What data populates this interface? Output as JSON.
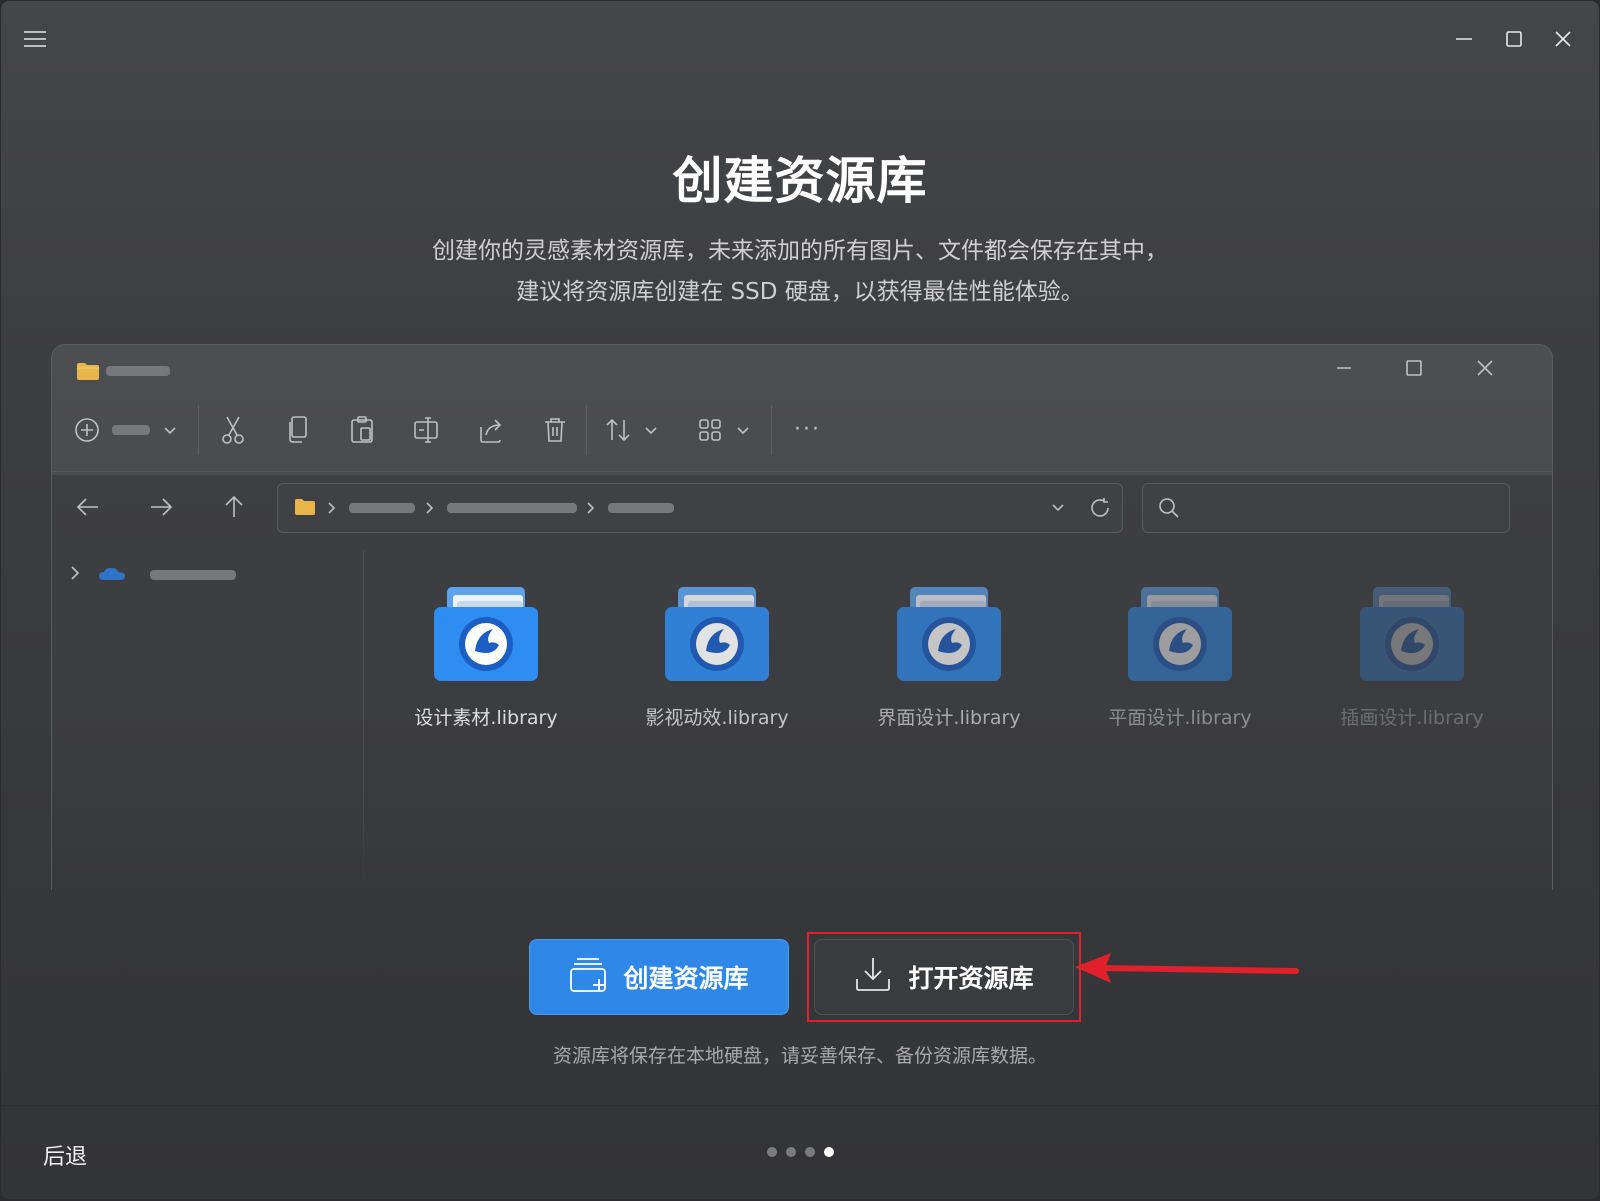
{
  "titlebar": {
    "menu_icon": "hamburger-menu-icon",
    "controls": [
      "minimize-icon",
      "maximize-icon",
      "close-icon"
    ]
  },
  "heading": "创建资源库",
  "subtitle_lines": [
    "创建你的灵感素材资源库，未来添加的所有图片、文件都会保存在其中，",
    "建议将资源库创建在 SSD 硬盘，以获得最佳性能体验。"
  ],
  "explorer": {
    "libraries": [
      {
        "label": "设计素材.library",
        "opacity": 1.0
      },
      {
        "label": "影视动效.library",
        "opacity": 0.85
      },
      {
        "label": "界面设计.library",
        "opacity": 0.7
      },
      {
        "label": "平面设计.library",
        "opacity": 0.5
      },
      {
        "label": "插画设计.library",
        "opacity": 0.3
      }
    ],
    "colors": {
      "folder_blue": "#2f8cf0",
      "folder_yellow": "#e8b64a"
    }
  },
  "buttons": {
    "create_label": "创建资源库",
    "open_label": "打开资源库"
  },
  "note": "资源库将保存在本地硬盘，请妥善保存、备份资源库数据。",
  "footer": {
    "back_label": "后退",
    "pager": {
      "total": 4,
      "current": 4
    }
  },
  "colors": {
    "accent": "#2f87e8",
    "highlight": "#e0202a"
  }
}
